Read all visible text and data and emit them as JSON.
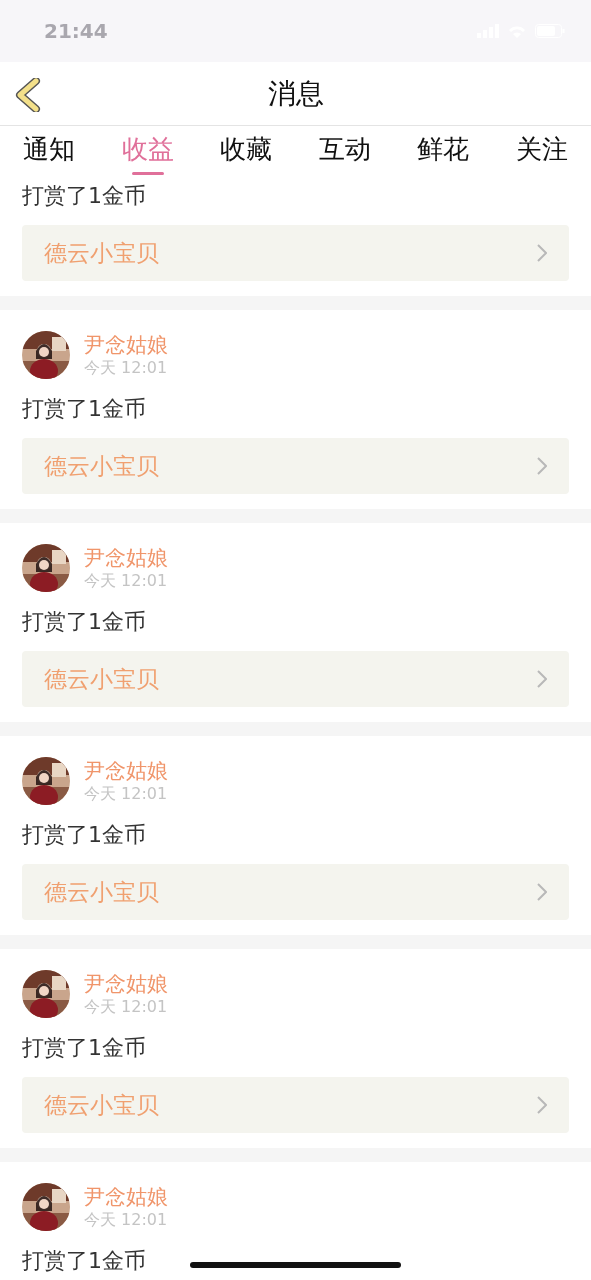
{
  "status_bar": {
    "time": "21:44"
  },
  "header": {
    "title": "消息"
  },
  "tabs": [
    {
      "label": "通知",
      "selected": false
    },
    {
      "label": "收益",
      "selected": true
    },
    {
      "label": "收藏",
      "selected": false
    },
    {
      "label": "互动",
      "selected": false
    },
    {
      "label": "鲜花",
      "selected": false
    },
    {
      "label": "关注",
      "selected": false
    }
  ],
  "messages": [
    {
      "text": "打赏了1金币",
      "link": "德云小宝贝"
    },
    {
      "author": "尹念姑娘",
      "time": "今天 12:01",
      "text": "打赏了1金币",
      "link": "德云小宝贝"
    },
    {
      "author": "尹念姑娘",
      "time": "今天 12:01",
      "text": "打赏了1金币",
      "link": "德云小宝贝"
    },
    {
      "author": "尹念姑娘",
      "time": "今天 12:01",
      "text": "打赏了1金币",
      "link": "德云小宝贝"
    },
    {
      "author": "尹念姑娘",
      "time": "今天 12:01",
      "text": "打赏了1金币",
      "link": "德云小宝贝"
    },
    {
      "author": "尹念姑娘",
      "time": "今天 12:01",
      "text": "打赏了1金币"
    }
  ]
}
